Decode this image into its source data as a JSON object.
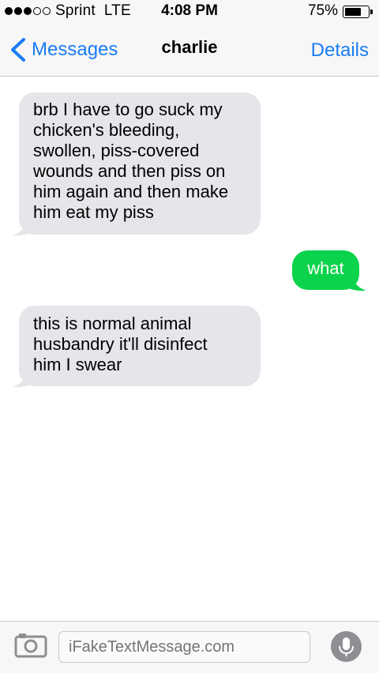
{
  "status_bar": {
    "carrier": "Sprint",
    "network": "LTE",
    "signal_bars_filled": 3,
    "signal_bars_total": 5,
    "time": "4:08 PM",
    "battery_percent": "75%",
    "battery_level": 0.75
  },
  "nav": {
    "back_label": "Messages",
    "title": "charlie",
    "details_label": "Details"
  },
  "messages": [
    {
      "direction": "incoming",
      "lines": [
        "brb I have to go suck my",
        "chicken's bleeding,",
        "swollen, piss-covered",
        "wounds and then piss on",
        "him again and then make",
        "him eat my piss"
      ]
    },
    {
      "direction": "outgoing",
      "lines": [
        "what"
      ]
    },
    {
      "direction": "incoming",
      "lines": [
        "this is normal animal",
        "husbandry it'll disinfect",
        "him I swear"
      ]
    }
  ],
  "composer": {
    "placeholder": "iFakeTextMessage.com"
  },
  "colors": {
    "accent": "#1a7cf5",
    "incoming_bubble": "#e5e5ea",
    "outgoing_bubble": "#0bd34b"
  }
}
